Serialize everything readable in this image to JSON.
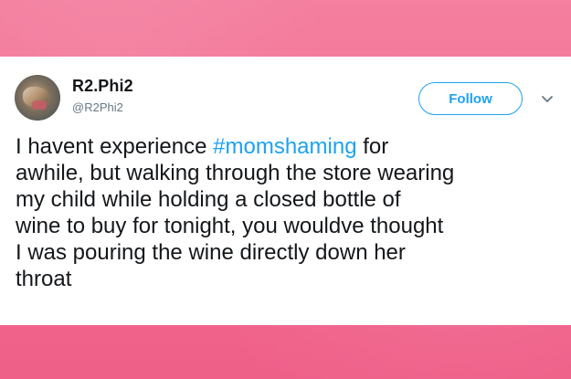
{
  "tweet": {
    "display_name": "R2.Phi2",
    "handle": "@R2Phi2",
    "follow_label": "Follow",
    "text": {
      "before_hashtag": "I havent experience ",
      "hashtag": "#momshaming",
      "after_hashtag": " for\nawhile, but walking through the store wearing\nmy child while holding a closed bottle of\nwine to buy for tonight, you wouldve thought\nI was pouring the wine directly down her\nthroat"
    }
  },
  "icons": {
    "menu_icon": "chevron-down-icon",
    "avatar_icon": "profile-avatar"
  },
  "colors": {
    "background_pink": "#f26d92",
    "card_background": "#ffffff",
    "twitter_blue": "#1da1f2",
    "primary_text": "#14171a",
    "secondary_text": "#657786"
  }
}
